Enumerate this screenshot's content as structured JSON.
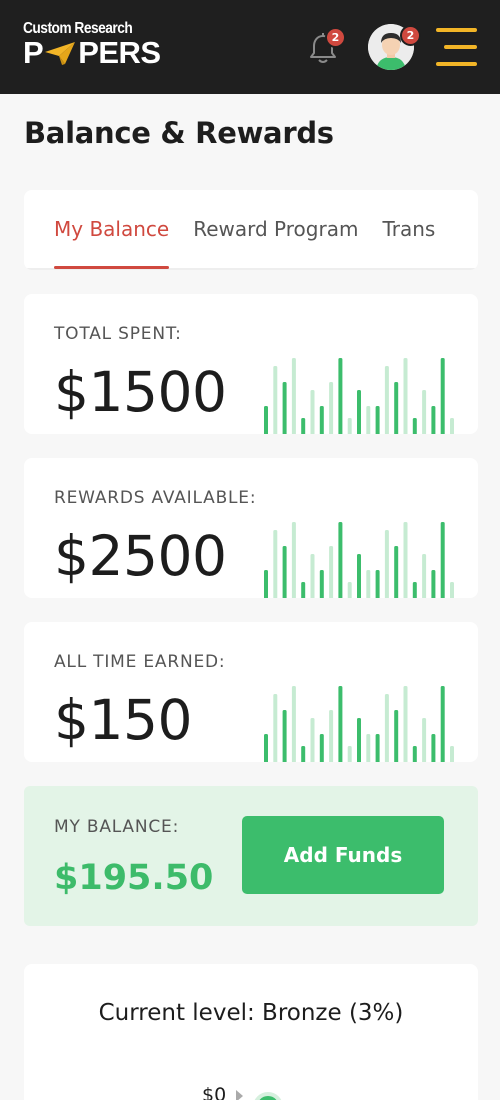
{
  "header": {
    "logo_top": "Custom Research",
    "logo_left": "P",
    "logo_right": "PERS",
    "notifications_count": "2",
    "profile_count": "2",
    "icons": [
      "bell-icon",
      "avatar",
      "hamburger-menu-icon"
    ],
    "accent_color": "#f2b527"
  },
  "page": {
    "title": "Balance & Rewards"
  },
  "tabs": [
    {
      "label": "My Balance",
      "active": true
    },
    {
      "label": "Reward Program",
      "active": false
    },
    {
      "label": "Trans",
      "active": false
    }
  ],
  "stats": [
    {
      "label": "TOTAL SPENT:",
      "value": "$1500"
    },
    {
      "label": "REWARDS AVAILABLE:",
      "value": "$2500"
    },
    {
      "label": "ALL TIME EARNED:",
      "value": "$150"
    }
  ],
  "balance": {
    "label": "MY BALANCE:",
    "value": "$195.50",
    "add_funds_label": "Add Funds"
  },
  "level": {
    "title": "Current level: Bronze (3%)",
    "start_label": "$0"
  },
  "colors": {
    "brand_red": "#d0493f",
    "green": "#3cbd6c",
    "light_green": "#c6ebd2",
    "balance_bg": "#e3f4e7",
    "header_bg": "#1f1f1f"
  }
}
